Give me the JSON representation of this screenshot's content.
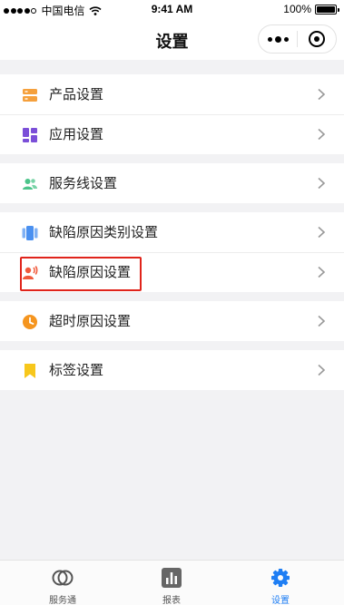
{
  "status_bar": {
    "carrier": "中国电信",
    "time": "9:41 AM",
    "battery": "100%"
  },
  "nav": {
    "title": "设置"
  },
  "groups": [
    {
      "items": [
        {
          "label": "产品设置",
          "icon": "product-icon",
          "color": "#f5a03c"
        },
        {
          "label": "应用设置",
          "icon": "app-grid-icon",
          "color": "#7b4fd8"
        }
      ]
    },
    {
      "items": [
        {
          "label": "服务线设置",
          "icon": "users-icon",
          "color": "#4cc48a"
        }
      ]
    },
    {
      "items": [
        {
          "label": "缺陷原因类别设置",
          "icon": "category-icon",
          "color": "#4a90f0"
        },
        {
          "label": "缺陷原因设置",
          "icon": "defect-person-icon",
          "color": "#f05a3c"
        }
      ]
    },
    {
      "items": [
        {
          "label": "超时原因设置",
          "icon": "clock-icon",
          "color": "#f5951f"
        }
      ]
    },
    {
      "items": [
        {
          "label": "标签设置",
          "icon": "bookmark-icon",
          "color": "#f7c71c"
        }
      ]
    }
  ],
  "tabbar": {
    "tabs": [
      {
        "label": "服务通",
        "icon": "service-icon"
      },
      {
        "label": "报表",
        "icon": "chart-icon"
      },
      {
        "label": "设置",
        "icon": "gear-icon",
        "active": true
      }
    ],
    "active_color": "#1e7ef4"
  }
}
